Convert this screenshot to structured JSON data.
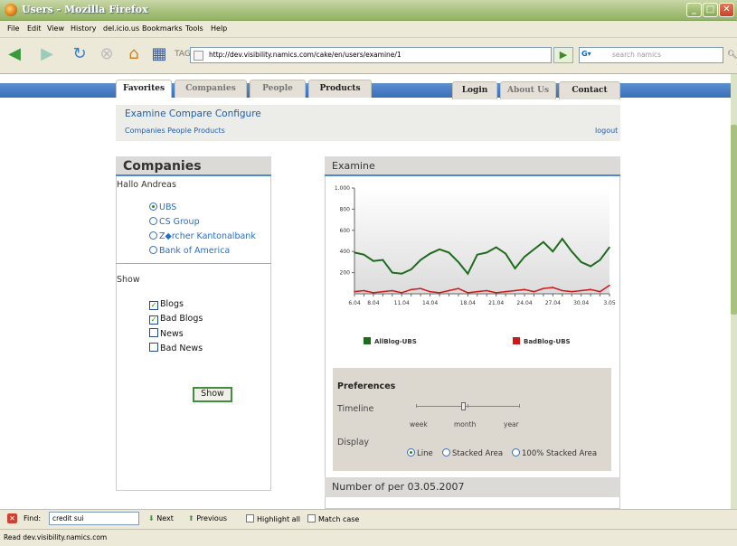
{
  "window": {
    "title": "Users - Mozilla Firefox"
  },
  "menu": [
    "File",
    "Edit",
    "View",
    "History",
    "del.icio.us",
    "Bookmarks",
    "Tools",
    "Help"
  ],
  "navbar": {
    "url": "http://dev.visibility.namics.com/cake/en/users/examine/1",
    "search_placeholder": "search namics"
  },
  "site": {
    "tabs_left": [
      "Favorites",
      "Companies",
      "People",
      "Products"
    ],
    "tabs_right": [
      "Login",
      "About Us",
      "Contact"
    ],
    "subnav_main": "Examine Compare Configure",
    "subnav_sub": "Companies People Products",
    "logout": "logout"
  },
  "companies": {
    "title": "Companies",
    "greeting": "Hallo Andreas",
    "options": [
      "UBS",
      "CS Group",
      "Z◆rcher Kantonalbank",
      "Bank of America"
    ],
    "selected": "UBS",
    "show_label": "Show",
    "filters": [
      {
        "label": "Blogs",
        "checked": true
      },
      {
        "label": "Bad Blogs",
        "checked": true
      },
      {
        "label": "News",
        "checked": false
      },
      {
        "label": "Bad News",
        "checked": false
      }
    ],
    "show_button": "Show"
  },
  "examine": {
    "title": "Examine",
    "preferences": {
      "title": "Preferences",
      "timeline_label": "Timeline",
      "timeline_options": [
        "week",
        "month",
        "year"
      ],
      "timeline_value": "month",
      "display_label": "Display",
      "display_options": [
        "Line",
        "Stacked Area",
        "100% Stacked Area"
      ],
      "display_selected": "Line"
    },
    "number_title": "Number of per 03.05.2007"
  },
  "chart_data": {
    "type": "line",
    "x": [
      "6.04",
      "7.04",
      "8.04",
      "9.04",
      "10.04",
      "11.04",
      "12.04",
      "13.04",
      "14.04",
      "15.04",
      "16.04",
      "17.04",
      "18.04",
      "19.04",
      "20.04",
      "21.04",
      "22.04",
      "23.04",
      "24.04",
      "25.04",
      "26.04",
      "27.04",
      "28.04",
      "29.04",
      "30.04",
      "1.05",
      "2.05",
      "3.05"
    ],
    "x_ticks": [
      "6.04",
      "8.04",
      "11.04",
      "14.04",
      "18.04",
      "21.04",
      "24.04",
      "27.04",
      "30.04",
      "3.05"
    ],
    "y_ticks": [
      "1.000",
      "800",
      "600",
      "400",
      "200"
    ],
    "ylim": [
      0,
      1000
    ],
    "series": [
      {
        "name": "AllBlog-UBS",
        "color": "#1e6b1e",
        "values": [
          390,
          370,
          310,
          320,
          200,
          190,
          230,
          320,
          380,
          420,
          390,
          300,
          190,
          370,
          390,
          440,
          380,
          240,
          350,
          420,
          490,
          400,
          520,
          400,
          300,
          260,
          320,
          440
        ]
      },
      {
        "name": "BadBlog-UBS",
        "color": "#d01818",
        "values": [
          20,
          30,
          10,
          20,
          30,
          10,
          40,
          50,
          20,
          10,
          30,
          50,
          10,
          20,
          30,
          10,
          20,
          30,
          40,
          20,
          50,
          60,
          30,
          20,
          30,
          40,
          20,
          80
        ]
      }
    ],
    "legend": "bottom"
  },
  "findbar": {
    "label": "Find:",
    "value": "credit sui",
    "next": "Next",
    "previous": "Previous",
    "highlight": "Highlight all",
    "match_case": "Match case"
  },
  "status": "Read dev.visibility.namics.com"
}
